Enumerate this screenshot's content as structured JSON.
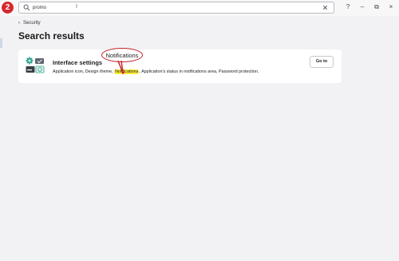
{
  "step_badge": "2",
  "search": {
    "value": "promo",
    "placeholder": ""
  },
  "window_controls": {
    "help": "?",
    "minimize": "–",
    "restore": "⧉",
    "close": "×"
  },
  "breadcrumb": {
    "label": "Security"
  },
  "page_title": "Search results",
  "results": [
    {
      "title": "Interface settings",
      "desc_before": "Application icon, Design theme, ",
      "desc_highlight": "Notifications",
      "desc_after": ", Application's status in notifications area, Password protection.",
      "button_label": "Go to"
    }
  ],
  "callout": {
    "text": "Notifications"
  },
  "colors": {
    "badge": "#d6282f",
    "highlight": "#ffef3a",
    "callout_border": "#c8202a",
    "icon_teal": "#2fa58c"
  }
}
